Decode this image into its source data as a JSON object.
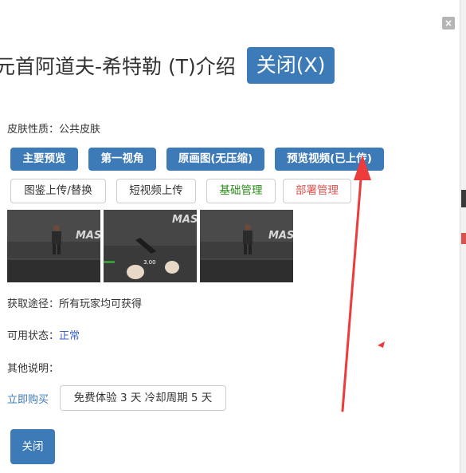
{
  "dialog": {
    "title": "元首阿道夫-希特勒 (T)介绍",
    "title_close_label": "关闭(X)",
    "close_icon_glyph": "×"
  },
  "skin_type": {
    "label": "皮肤性质：",
    "value": "公共皮肤"
  },
  "primary_buttons": [
    "主要预览",
    "第一视角",
    "原画图(无压缩)",
    "预览视频(已上传)"
  ],
  "secondary_buttons": [
    "图鉴上传/替换",
    "短视频上传",
    "基础管理",
    "部署管理"
  ],
  "thumbnails": [
    {
      "overlay_text": "MAS"
    },
    {
      "overlay_text": "MAS",
      "hud_value": "3.00"
    },
    {
      "overlay_text": "MAS"
    }
  ],
  "acquire": {
    "label": "获取途径：",
    "value": "所有玩家均可获得"
  },
  "status": {
    "label": "可用状态：",
    "value": "正常"
  },
  "other": {
    "label": "其他说明：",
    "value": ""
  },
  "buy_link": "立即购买",
  "trial_button": "免费体验 3 天 冷却周期 5 天",
  "bottom_close": "关闭",
  "colors": {
    "primary": "#3c7ab8",
    "link": "#3c7ab8",
    "status_normal": "#3c62c8",
    "green_text": "#2e8b1e",
    "red_text": "#d9534f",
    "annotation_arrow": "#ee3b3b"
  }
}
